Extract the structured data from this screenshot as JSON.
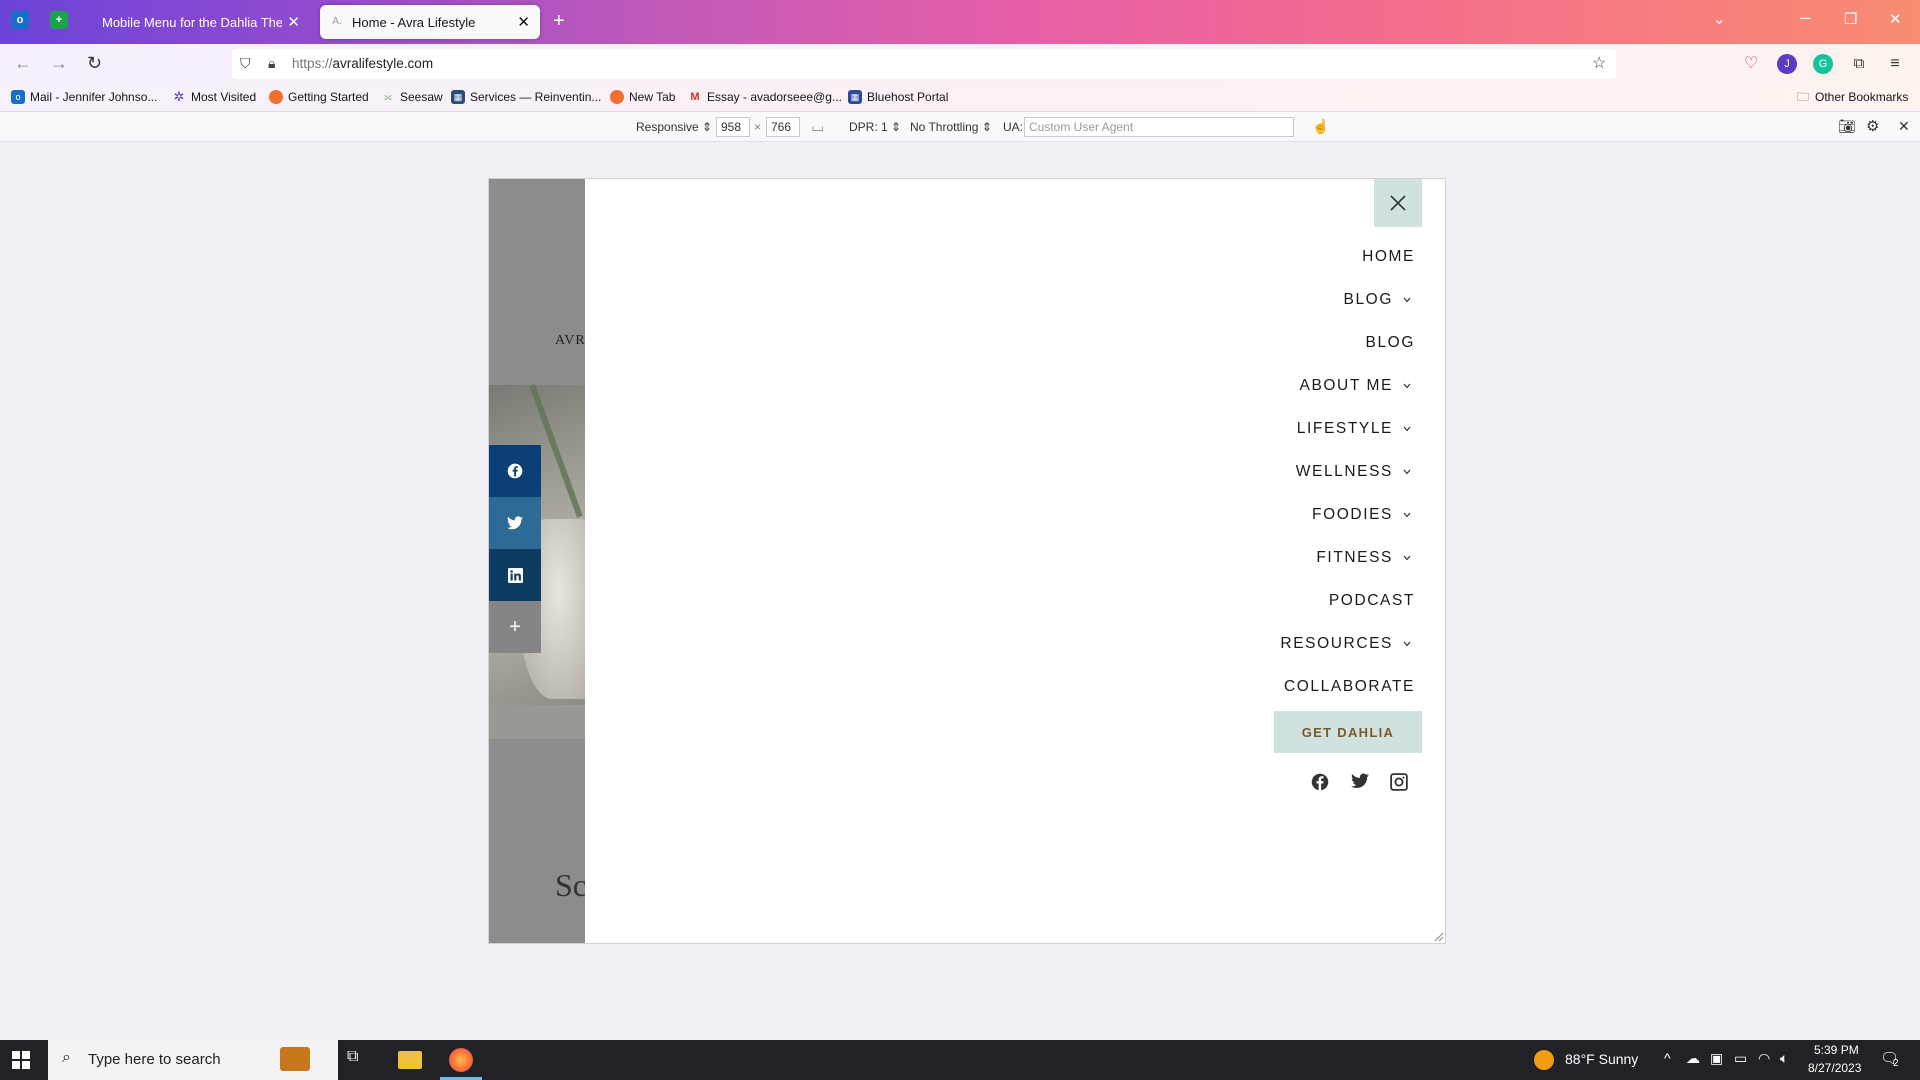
{
  "browser": {
    "tabs": [
      {
        "label": "Mobile Menu for the Dahlia Theme",
        "active": false
      },
      {
        "label": "Home - Avra Lifestyle",
        "active": true
      }
    ],
    "url_prefix": "https://",
    "url_domain": "avralifestyle.com",
    "bookmarks": [
      {
        "label": "Mail - Jennifer Johnso...",
        "icon": "outlook-icon"
      },
      {
        "label": "Most Visited",
        "icon": "gear-icon"
      },
      {
        "label": "Getting Started",
        "icon": "firefox-icon"
      },
      {
        "label": "Seesaw",
        "icon": "seesaw-icon"
      },
      {
        "label": "Services — Reinventin...",
        "icon": "grid-icon"
      },
      {
        "label": "New Tab",
        "icon": "firefox-icon"
      },
      {
        "label": "Essay - avadorseee@g...",
        "icon": "gmail-icon"
      },
      {
        "label": "Bluehost Portal",
        "icon": "grid-icon"
      }
    ],
    "other_bookmarks": "Other Bookmarks"
  },
  "rdm": {
    "device": "Responsive",
    "width": "958",
    "times": "×",
    "height": "766",
    "dpr": "DPR: 1",
    "throttling": "No Throttling",
    "ua_label": "UA:",
    "ua_placeholder": "Custom User Agent"
  },
  "page": {
    "logo_fragment": "AVR",
    "script_fragment": "Sc",
    "share_more": "+"
  },
  "menu": {
    "items": [
      {
        "label": "HOME",
        "has_children": false
      },
      {
        "label": "BLOG",
        "has_children": true
      },
      {
        "label": "BLOG",
        "has_children": false
      },
      {
        "label": "ABOUT ME",
        "has_children": true
      },
      {
        "label": "LIFESTYLE",
        "has_children": true
      },
      {
        "label": "WELLNESS",
        "has_children": true
      },
      {
        "label": "FOODIES",
        "has_children": true
      },
      {
        "label": "FITNESS",
        "has_children": true
      },
      {
        "label": "PODCAST",
        "has_children": false
      },
      {
        "label": "RESOURCES",
        "has_children": true
      },
      {
        "label": "COLLABORATE",
        "has_children": false
      }
    ],
    "cta_label": "GET DAHLIA",
    "accent_color": "#cfe2df",
    "cta_text_color": "#7a5a2a"
  },
  "taskbar": {
    "search_placeholder": "Type here to search",
    "weather": "88°F  Sunny",
    "time": "5:39 PM",
    "date": "8/27/2023",
    "notification_count": "2"
  }
}
